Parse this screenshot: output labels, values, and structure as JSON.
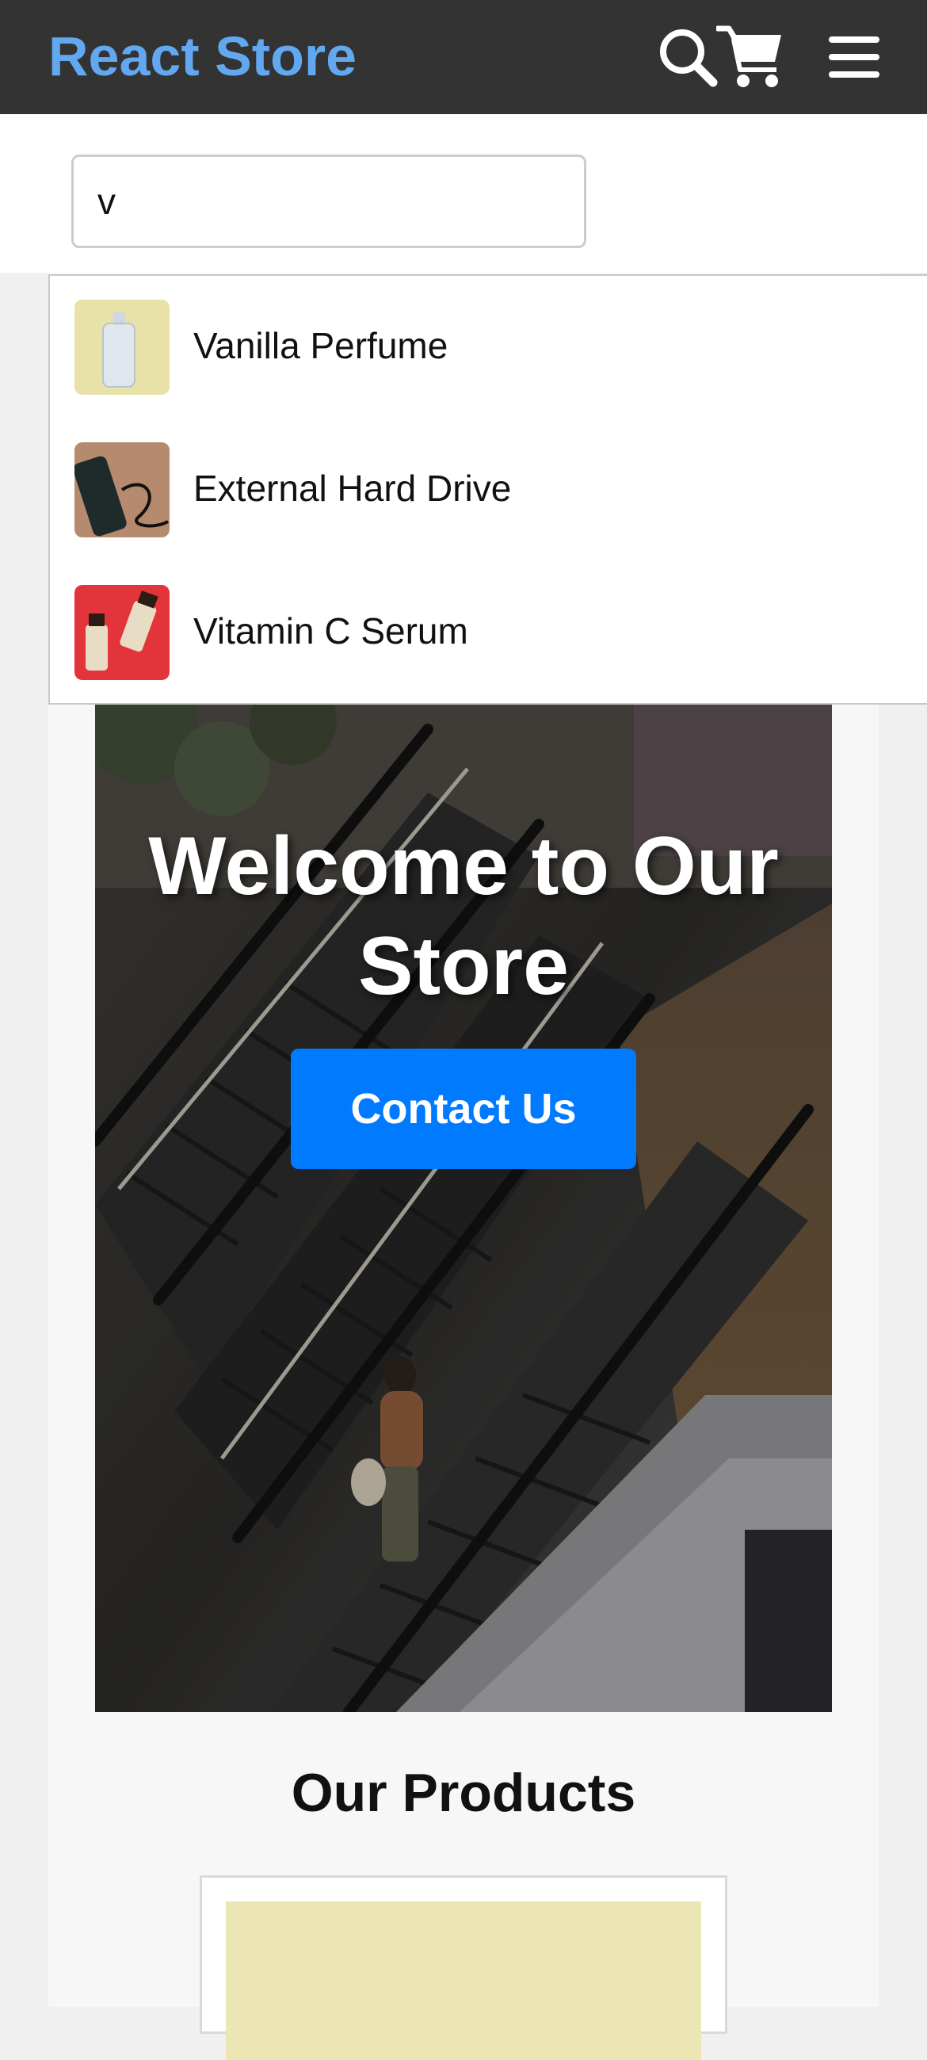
{
  "navbar": {
    "brand": "React Store",
    "icons": [
      "search-icon",
      "cart-icon",
      "menu-icon"
    ],
    "colors": {
      "background": "#333333",
      "brand": "#61a8f0"
    }
  },
  "search": {
    "value": "v",
    "placeholder": ""
  },
  "results": [
    {
      "name": "Vanilla Perfume",
      "thumb": "perfume-bottle"
    },
    {
      "name": "External Hard Drive",
      "thumb": "hard-drive"
    },
    {
      "name": "Vitamin C Serum",
      "thumb": "serum-bottles"
    }
  ],
  "hero": {
    "title": "Welcome to Our Store",
    "button_label": "Contact Us",
    "colors": {
      "button": "#007bff"
    }
  },
  "products": {
    "heading": "Our Products"
  }
}
